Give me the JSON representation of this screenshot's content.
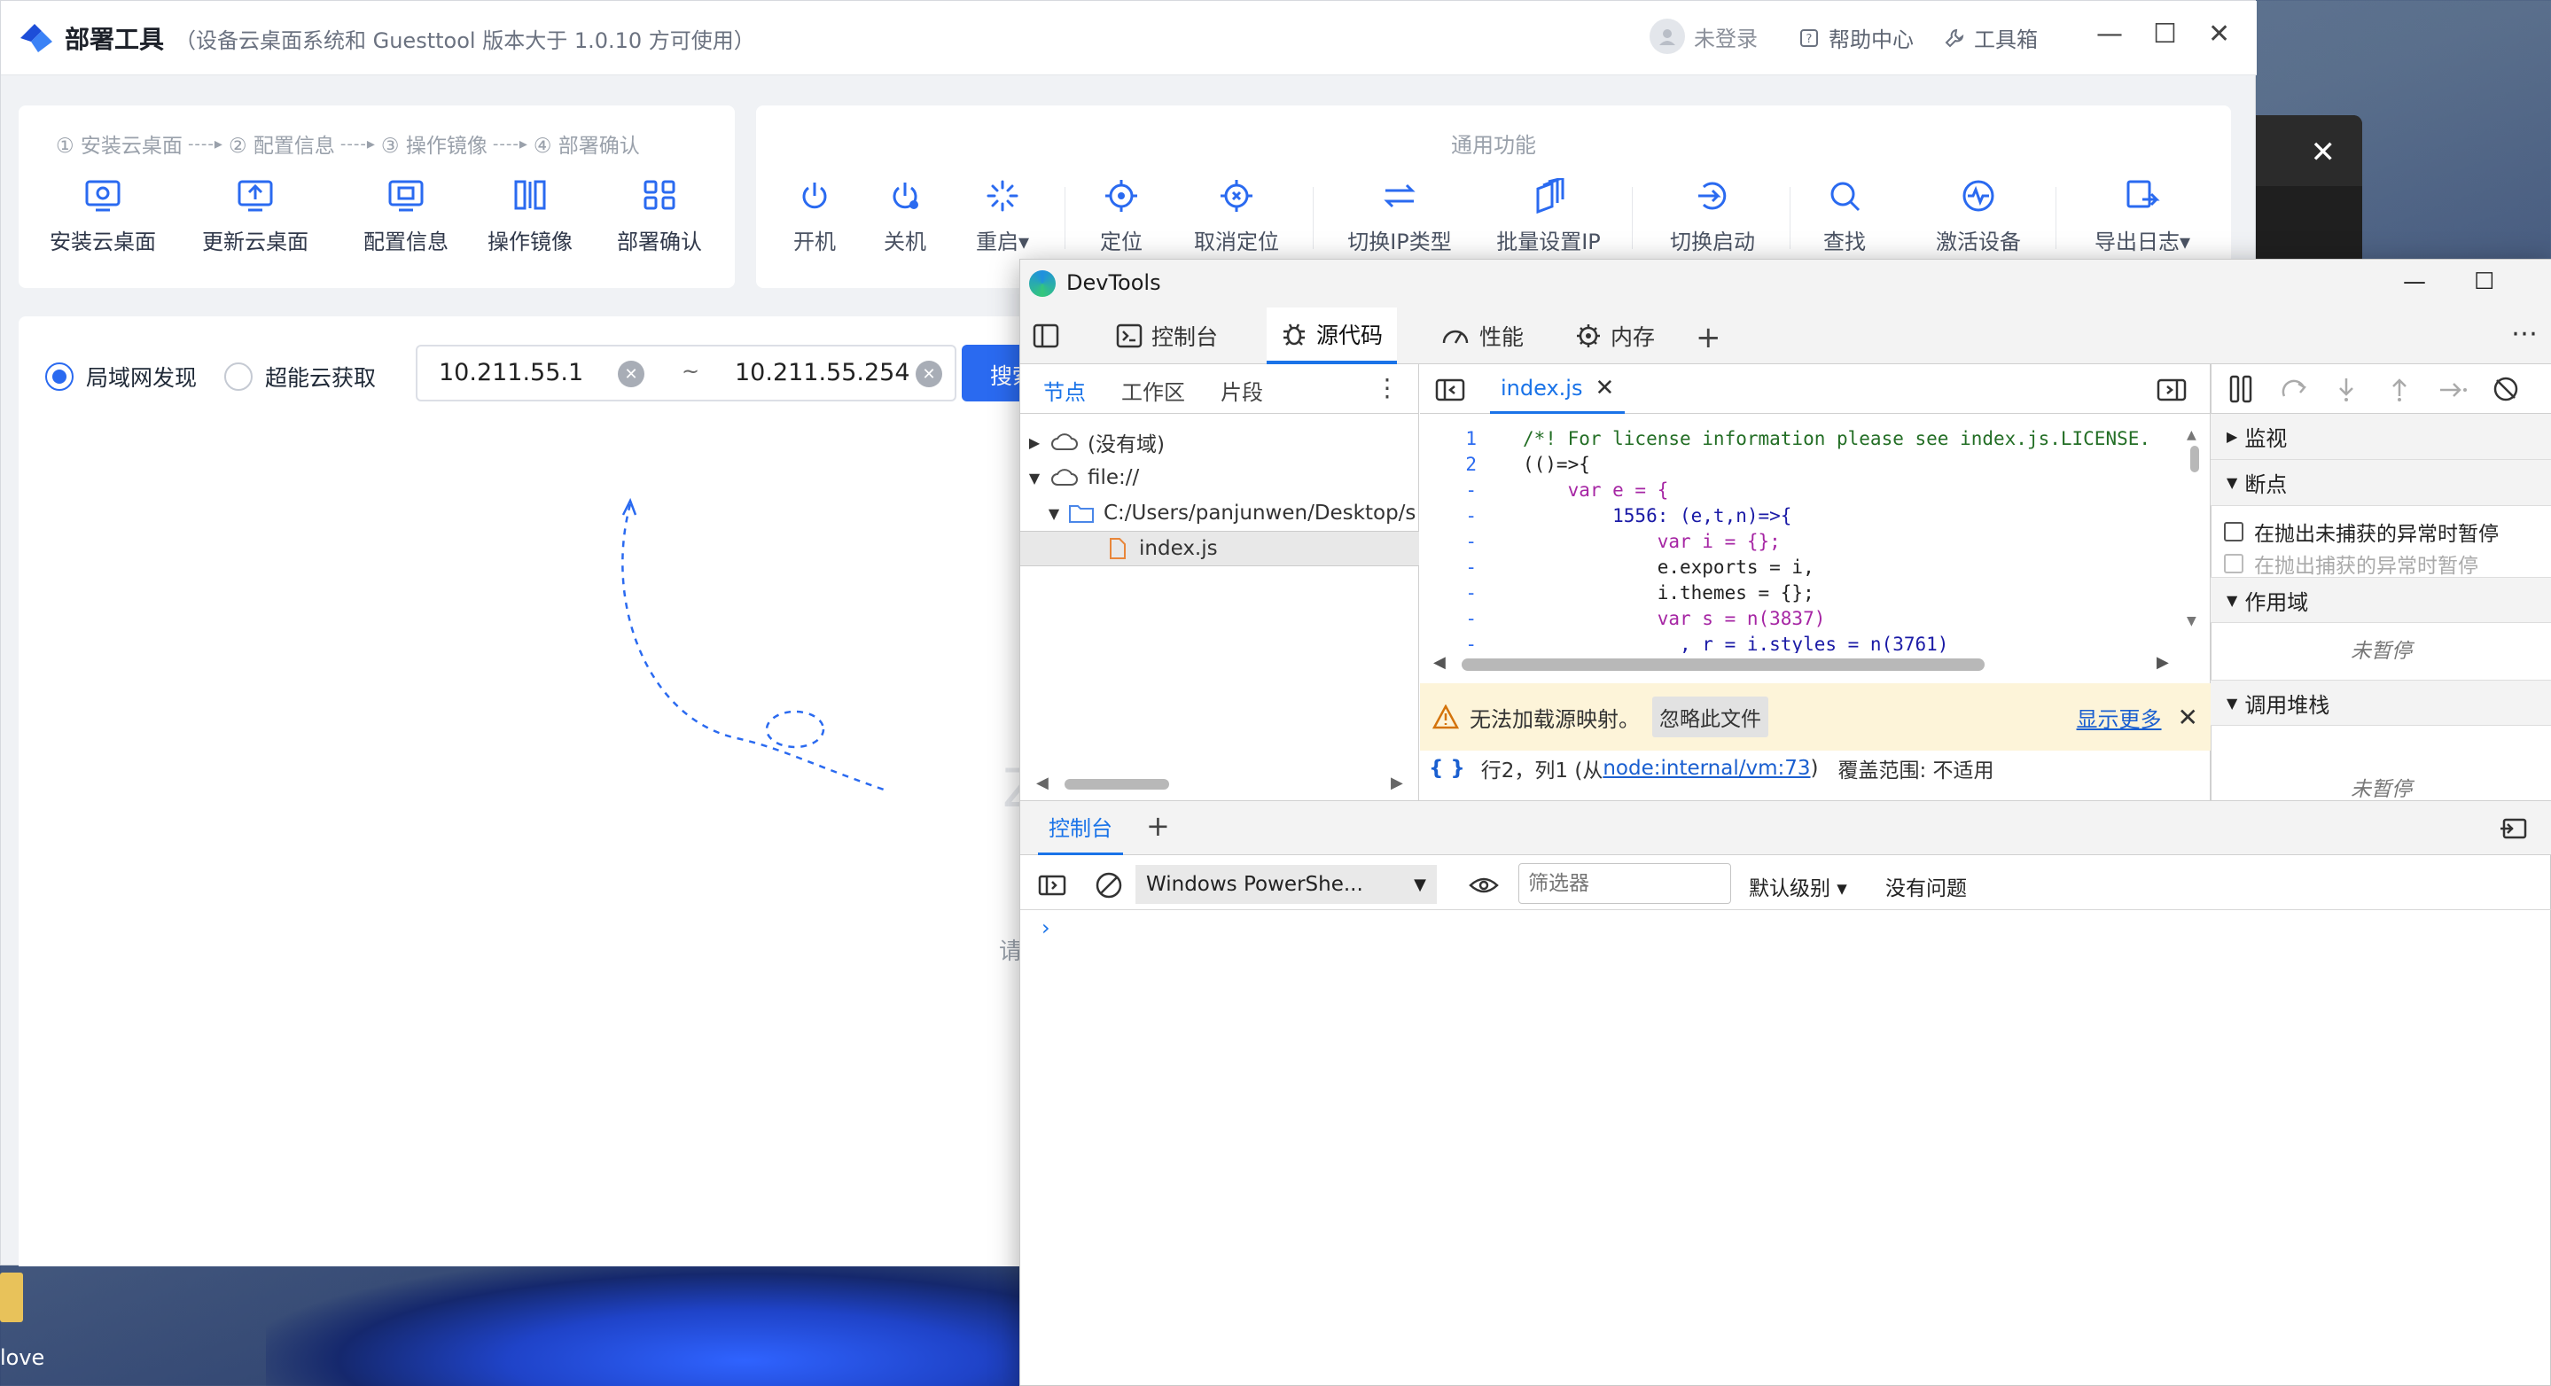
{
  "app": {
    "title": "部署工具",
    "subtitle": "（设备云桌面系统和 Guesttool 版本大于 1.0.10 方可使用）",
    "user": "未登录",
    "help": "帮助中心",
    "tools": "工具箱"
  },
  "steps": {
    "labels": [
      "① 安装云桌面",
      "② 配置信息",
      "③ 操作镜像",
      "④ 部署确认"
    ],
    "arrow": "----▸",
    "buttons": [
      "安装云桌面",
      "更新云桌面",
      "配置信息",
      "操作镜像",
      "部署确认"
    ]
  },
  "functions": {
    "title": "通用功能",
    "buttons": [
      "开机",
      "关机",
      "重启▾",
      "定位",
      "取消定位",
      "切换IP类型",
      "批量设置IP",
      "切换启动",
      "查找",
      "激活设备",
      "导出日志▾"
    ]
  },
  "search": {
    "radio_lan": "局域网发现",
    "radio_cloud": "超能云获取",
    "ip_start": "10.211.55.1",
    "tilde": "~",
    "ip_end": "10.211.55.254",
    "button": "搜索",
    "hint_fragment": "请"
  },
  "devtools": {
    "title": "DevTools",
    "tabs": [
      "控制台",
      "源代码",
      "性能",
      "内存"
    ],
    "nav_tabs": [
      "节点",
      "工作区",
      "片段"
    ],
    "tree": [
      "(没有域)",
      "file://",
      "C:/Users/panjunwen/Desktop/s",
      "index.js"
    ],
    "file_tab": "index.js",
    "code": [
      {
        "ln": "1",
        "text": "/*! For license information please see index.js.LICENSE."
      },
      {
        "ln": "2",
        "text": "(()=>{"
      },
      {
        "ln": "-",
        "text": "    var e = {"
      },
      {
        "ln": "-",
        "text": "        1556: (e,t,n)=>{"
      },
      {
        "ln": "-",
        "text": "            var i = {};"
      },
      {
        "ln": "-",
        "text": "            e.exports = i,"
      },
      {
        "ln": "-",
        "text": "            i.themes = {};"
      },
      {
        "ln": "-",
        "text": "            var s = n(3837)"
      },
      {
        "ln": "-",
        "text": "              , r = i.styles = n(3761)"
      }
    ],
    "warning": "无法加载源映射。",
    "ignore_button": "忽略此文件",
    "show_more": "显示更多",
    "status_pos": "行2，列1 (从",
    "status_link": "node:internal/vm:73",
    "status_end": ")",
    "coverage": "覆盖范围: 不适用",
    "debug_sections": [
      "监视",
      "断点",
      "作用域",
      "调用堆栈"
    ],
    "bp_checks": [
      "在抛出未捕获的异常时暂停",
      "在抛出捕获的异常时暂停"
    ],
    "not_paused": "未暂停",
    "drawer_tab": "控制台",
    "context": "Windows PowerShe...",
    "filter_placeholder": "筛选器",
    "level": "默认级别 ▾",
    "issues": "没有问题",
    "prompt": "›"
  },
  "desktop": {
    "icon_label": "love"
  },
  "colors": {
    "accent": "#2a6af0",
    "devtools_accent": "#1a73e8",
    "warning_bg": "#fdf4d9"
  }
}
